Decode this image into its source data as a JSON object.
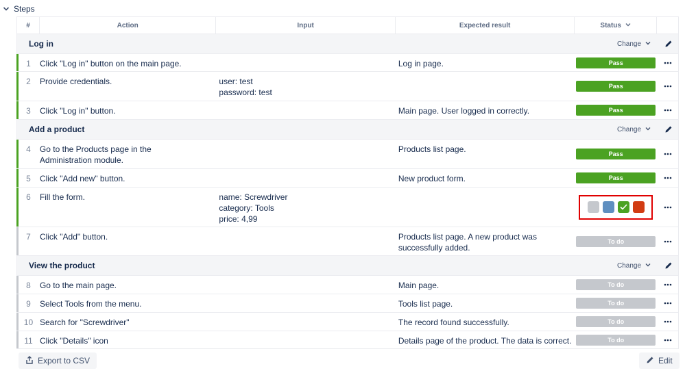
{
  "section": {
    "title": "Steps"
  },
  "columns": {
    "num": "#",
    "action": "Action",
    "input": "Input",
    "expected": "Expected result",
    "status": "Status"
  },
  "colors": {
    "pass": "#4ba222",
    "todo": "#c5c8cd",
    "swatch_gray": "#c5c8cd",
    "swatch_blue": "#5f8fc0",
    "swatch_green": "#4ba222",
    "swatch_red": "#d23c13",
    "highlight": "#e00000"
  },
  "groups": [
    {
      "title": "Log in",
      "change_label": "Change",
      "steps": [
        {
          "num": "1",
          "action": "Click \"Log in\" button on the main page.",
          "input": "",
          "expected": "Log in page.",
          "status": "Pass"
        },
        {
          "num": "2",
          "action": "Provide credentials.",
          "input": "user: test\npassword: test",
          "expected": "",
          "status": "Pass"
        },
        {
          "num": "3",
          "action": "Click \"Log in\" button.",
          "input": "",
          "expected": "Main page. User logged in correctly.",
          "status": "Pass"
        }
      ]
    },
    {
      "title": "Add a product",
      "change_label": "Change",
      "steps": [
        {
          "num": "4",
          "action": "Go to the Products page in the Administration module.",
          "input": "",
          "expected": "Products list page.",
          "status": "Pass"
        },
        {
          "num": "5",
          "action": "Click \"Add new\" button.",
          "input": "",
          "expected": "New product form.",
          "status": "Pass"
        },
        {
          "num": "6",
          "action": "Fill the form.",
          "input": "name: Screwdriver\ncategory: Tools\nprice: 4,99",
          "expected": "",
          "status": ""
        },
        {
          "num": "7",
          "action": "Click \"Add\" button.",
          "input": "",
          "expected": "Products list page. A new product was successfully added.",
          "status": "To do"
        }
      ]
    },
    {
      "title": "View the product",
      "change_label": "Change",
      "steps": [
        {
          "num": "8",
          "action": "Go to the main page.",
          "input": "",
          "expected": "Main page.",
          "status": "To do"
        },
        {
          "num": "9",
          "action": "Select Tools from the menu.",
          "input": "",
          "expected": "Tools list page.",
          "status": "To do"
        },
        {
          "num": "10",
          "action": "Search for \"Screwdriver\"",
          "input": "",
          "expected": "The record found successfully.",
          "status": "To do"
        },
        {
          "num": "11",
          "action": "Click \"Details\" icon",
          "input": "",
          "expected": "Details page of the product. The data is correct.",
          "status": "To do"
        }
      ]
    }
  ],
  "footer": {
    "export_label": "Export to CSV",
    "edit_label": "Edit"
  }
}
